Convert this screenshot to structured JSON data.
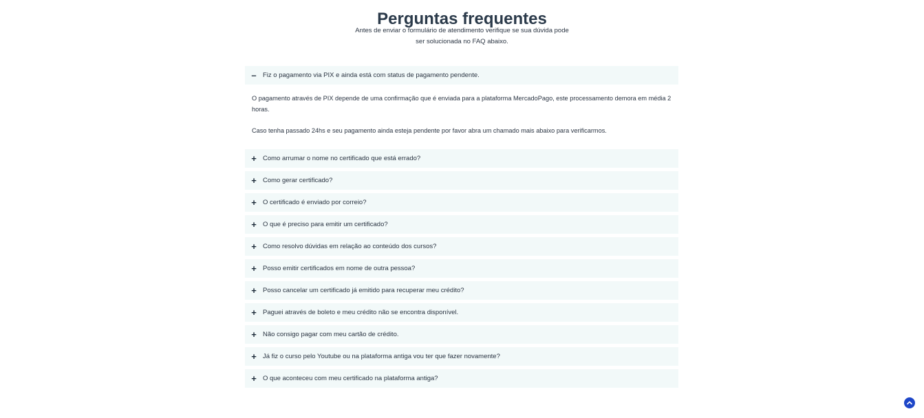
{
  "header": {
    "title": "Perguntas frequentes",
    "subtitle_line1": "Antes de enviar o formulário de atendimento verifique se sua dúvida pode",
    "subtitle_line2": "ser solucionada no FAQ abaixo."
  },
  "faq": {
    "expanded": {
      "toggle": "–",
      "question": "Fiz o pagamento via PIX e ainda está com status de pagamento pendente.",
      "answer_p1": "O pagamento através de PIX depende de uma confirmação que é enviada para a plataforma MercadoPago, este processamento demora em média 2 horas.",
      "answer_p2": "Caso tenha passado 24hs e seu pagamento ainda esteja pendente por favor abra um chamado mais abaixo para verificarmos."
    },
    "collapsed_toggle": "+",
    "items": [
      {
        "question": "Como arrumar o nome no certificado que está errado?"
      },
      {
        "question": "Como gerar certificado?"
      },
      {
        "question": "O certificado é enviado por correio?"
      },
      {
        "question": "O que é preciso para emitir um certificado?"
      },
      {
        "question": "Como resolvo dúvidas em relação ao conteúdo dos cursos?"
      },
      {
        "question": "Posso emitir certificados em nome de outra pessoa?"
      },
      {
        "question": "Posso cancelar um certificado já emitido para recuperar meu crédito?"
      },
      {
        "question": "Paguei através de boleto e meu crédito não se encontra disponível."
      },
      {
        "question": "Não consigo pagar com meu cartão de crédito."
      },
      {
        "question": "Já fiz o curso pelo Youtube ou na plataforma antiga vou ter que fazer novamente?"
      },
      {
        "question": "O que aconteceu com meu certificado na plataforma antiga?"
      }
    ]
  },
  "scroll_top": {
    "icon": "chevron-up-icon",
    "color": "#1d46c8"
  }
}
